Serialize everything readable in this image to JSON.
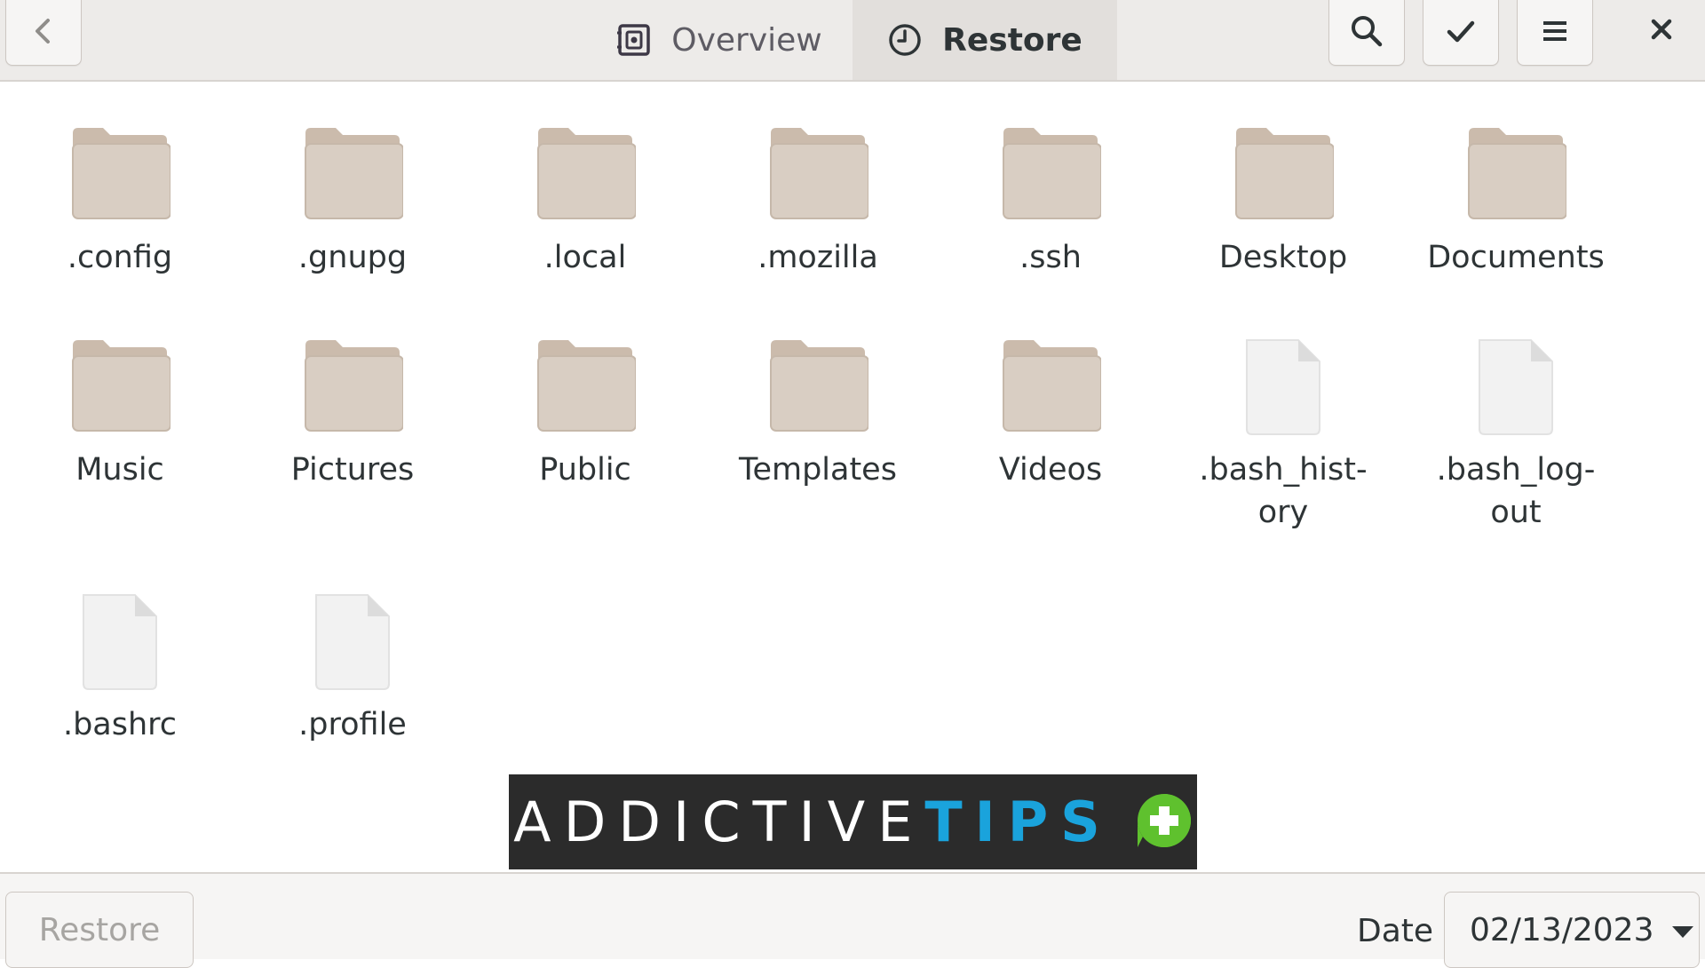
{
  "header": {
    "tabs": [
      {
        "label": "Overview",
        "icon": "archive-icon",
        "active": false
      },
      {
        "label": "Restore",
        "icon": "clock-icon",
        "active": true
      }
    ],
    "buttons": {
      "back": "back-arrow-icon",
      "search": "search-icon",
      "select": "checkmark-icon",
      "menu": "hamburger-menu-icon",
      "close": "close-icon"
    }
  },
  "files": {
    "items": [
      {
        "label": ".config",
        "type": "folder"
      },
      {
        "label": ".gnupg",
        "type": "folder"
      },
      {
        "label": ".local",
        "type": "folder"
      },
      {
        "label": ".mozilla",
        "type": "folder"
      },
      {
        "label": ".ssh",
        "type": "folder"
      },
      {
        "label": "Desktop",
        "type": "folder"
      },
      {
        "label": "Documents",
        "type": "folder"
      },
      {
        "label": "Music",
        "type": "folder"
      },
      {
        "label": "Pictures",
        "type": "folder"
      },
      {
        "label": "Public",
        "type": "folder"
      },
      {
        "label": "Templates",
        "type": "folder"
      },
      {
        "label": "Videos",
        "type": "folder"
      },
      {
        "label": ".bash_hist-\nory",
        "type": "file"
      },
      {
        "label": ".bash_log-\nout",
        "type": "file"
      },
      {
        "label": ".bashrc",
        "type": "file"
      },
      {
        "label": ".profile",
        "type": "file"
      }
    ]
  },
  "watermark": {
    "text_light": "ADDICTIVE",
    "text_bold": "TIPS",
    "badge": "+"
  },
  "footer": {
    "restore_label": "Restore",
    "date_label": "Date",
    "date_value": "02/13/2023"
  },
  "colors": {
    "folder": "#d9cec3",
    "folder_tab": "#cbbbac",
    "file": "#f2f2f2",
    "watermark_bg": "#2b2b2b",
    "watermark_accent": "#1aa3dc",
    "badge": "#5fc12e"
  }
}
